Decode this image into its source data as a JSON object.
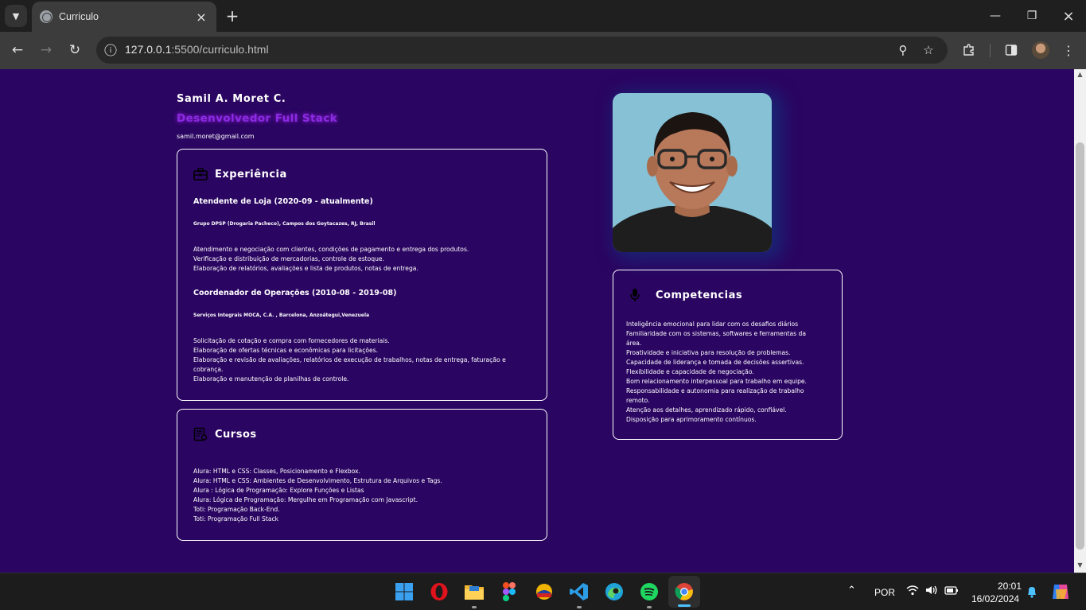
{
  "browser": {
    "tab_title": "Curriculo",
    "url_host": "127.0.0.1",
    "url_rest": ":5500/curriculo.html"
  },
  "page": {
    "name": "Samil A. Moret C.",
    "role": "Desenvolvedor Full Stack",
    "email": "samil.moret@gmail.com"
  },
  "experience": {
    "title": "Experiência",
    "jobs": [
      {
        "title": "Atendente de Loja (2020-09 - atualmente)",
        "company": "Grupo DPSP (Drogaria Pacheco), Campos dos Goytacazes, RJ, Brasil",
        "lines": [
          "Atendimento e negociação com clientes, condições de pagamento e entrega dos produtos.",
          "Verificação e distribuição de mercadorias, controle de estoque.",
          "Elaboração de relatórios, avaliações e lista de produtos, notas de entrega."
        ]
      },
      {
        "title": "Coordenador de Operações (2010-08 - 2019-08)",
        "company": "Serviços Integrais MOCA, C.A. , Barcelona, Anzoátegui,Venezuela",
        "lines": [
          "Solicitação de cotação e compra com fornecedores de materiais.",
          "Elaboração de ofertas técnicas e econômicas para licitações.",
          "Elaboração e revisão de avaliações, relatórios de execução de trabalhos, notas de entrega, faturação e",
          "cobrança.",
          "Elaboração e manutenção de planilhas de controle."
        ]
      }
    ]
  },
  "courses": {
    "title": "Cursos",
    "lines": [
      "Alura: HTML e CSS: Classes, Posicionamento e Flexbox.",
      "Alura: HTML e CSS: Ambientes de Desenvolvimento, Estrutura de Arquivos e Tags.",
      "Alura : Lógica de Programação: Explore Funções e Listas",
      "Alura: Lógica de Programação: Mergulhe em Programação com Javascript.",
      "Toti: Programação Back-End.",
      "Toti: Programação Full Stack"
    ]
  },
  "skills": {
    "title": "Competencias",
    "lines": [
      "Inteligência emocional para lidar com os desafios diários",
      "Familiaridade com os sistemas, softwares e ferramentas da",
      "área.",
      "Proatividade e iniciativa para resolução de problemas.",
      "Capacidade de liderança e tomada de decisões assertivas.",
      "Flexibilidade e capacidade de negociação.",
      "Bom relacionamento interpessoal para trabalho em equipe.",
      "Responsabilidade e autonomia para realização de trabalho",
      "remoto.",
      "Atenção aos detalhes, aprendizado rápido, confiável.",
      "Disposição para aprimoramento contínuos."
    ]
  },
  "taskbar": {
    "language": "POR",
    "time": "20:01",
    "date": "16/02/2024",
    "apps": [
      "windows-start",
      "opera",
      "file-explorer",
      "figma",
      "pcloud",
      "vscode",
      "edge",
      "spotify",
      "chrome"
    ]
  },
  "colors": {
    "page_bg": "#2a0561",
    "role_accent": "#8a2be2",
    "photo_bg": "#86c1d6"
  }
}
